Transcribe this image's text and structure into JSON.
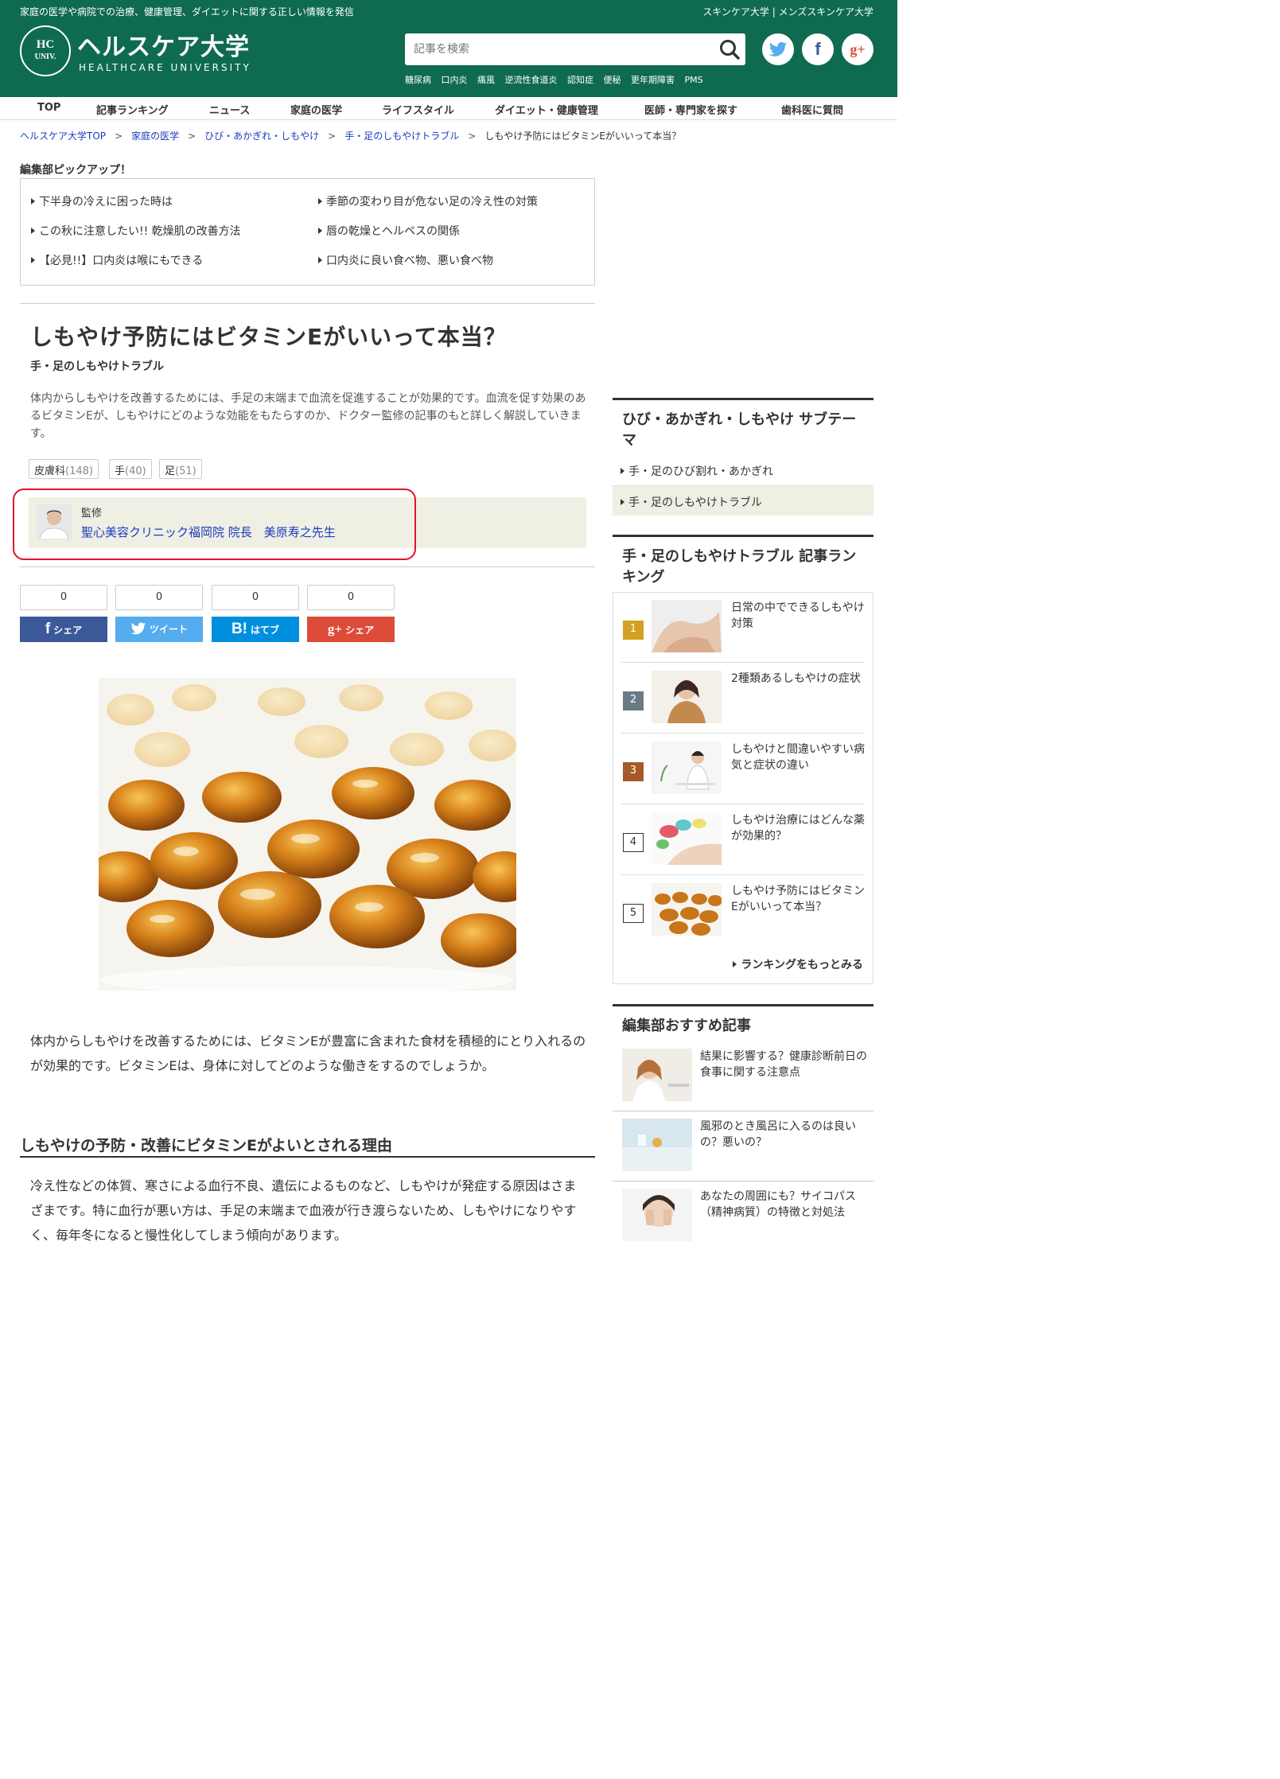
{
  "header": {
    "tagline": "家庭の医学や病院での治療、健康管理、ダイエットに関する正しい情報を発信",
    "top_link1": "スキンケア大学",
    "top_sep": "|",
    "top_link2": "メンズスキンケア大学",
    "logo_mark_line1": "HC",
    "logo_mark_line2": "UNIV.",
    "logo_title": "ヘルスケア大学",
    "logo_sub": "HEALTHCARE UNIVERSITY",
    "search_placeholder": "記事を検索",
    "keywords": [
      "糖尿病",
      "口内炎",
      "痛風",
      "逆流性食道炎",
      "認知症",
      "便秘",
      "更年期障害",
      "PMS"
    ],
    "social": [
      "twitter",
      "facebook",
      "google-plus"
    ]
  },
  "nav": [
    "TOP",
    "記事ランキング",
    "ニュース",
    "家庭の医学",
    "ライフスタイル",
    "ダイエット・健康管理",
    "医師・専門家を探す",
    "歯科医に質問"
  ],
  "breadcrumb": {
    "items": [
      "ヘルスケア大学TOP",
      "家庭の医学",
      "ひび・あかぎれ・しもやけ",
      "手・足のしもやけトラブル",
      "しもやけ予防にはビタミンEがいいって本当？"
    ],
    "sep": ">"
  },
  "picks": {
    "title": "編集部ピックアップ！",
    "items": [
      "下半身の冷えに困った時は",
      "季節の変わり目が危ない足の冷え性の対策",
      "この秋に注意したい!! 乾燥肌の改善方法",
      "唇の乾燥とヘルペスの関係",
      "【必見!!】口内炎は喉にもできる",
      "口内炎に良い食べ物、悪い食べ物"
    ]
  },
  "article": {
    "title": "しもやけ予防にはビタミンEがいいって本当？",
    "category": "手・足のしもやけトラブル",
    "lead": "体内からしもやけを改善するためには、手足の末端まで血流を促進することが効果的です。血流を促す効果のあるビタミンEが、しもやけにどのような効能をもたらすのか、ドクター監修の記事のもと詳しく解説していきます。",
    "tags": [
      {
        "name": "皮膚科",
        "count": "(148)"
      },
      {
        "name": "手",
        "count": "(40)"
      },
      {
        "name": "足",
        "count": "(51)"
      }
    ],
    "supervisor_label": "監修",
    "supervisor_name": "聖心美容クリニック福岡院 院長　美原寿之先生",
    "share_counts": [
      "0",
      "0",
      "0",
      "0"
    ],
    "share_labels": [
      "シェア",
      "ツイート",
      "はてブ",
      "シェア"
    ],
    "share_icons": [
      "f",
      "",
      "B!",
      "g+"
    ],
    "body1": "体内からしもやけを改善するためには、ビタミンEが豊富に含まれた食材を積極的にとり入れるのが効果的です。ビタミンEは、身体に対してどのような働きをするのでしょうか。",
    "h2": "しもやけの予防・改善にビタミンEがよいとされる理由",
    "body2": "冷え性などの体質、寒さによる血行不良、遺伝によるものなど、しもやけが発症する原因はさまざまです。特に血行が悪い方は、手足の末端まで血液が行き渡らないため、しもやけになりやすく、毎年冬になると慢性化してしまう傾向があります。"
  },
  "sidebar": {
    "subtheme_title": "ひび・あかぎれ・しもやけ サブテーマ",
    "subtheme_items": [
      "手・足のひび割れ・あかぎれ",
      "手・足のしもやけトラブル"
    ],
    "ranking_title": "手・足のしもやけトラブル 記事ランキング",
    "ranking": [
      {
        "rank": "1",
        "title": "日常の中でできるしもやけ対策"
      },
      {
        "rank": "2",
        "title": "2種類あるしもやけの症状"
      },
      {
        "rank": "3",
        "title": "しもやけと間違いやすい病気と症状の違い"
      },
      {
        "rank": "4",
        "title": "しもやけ治療にはどんな薬が効果的？"
      },
      {
        "rank": "5",
        "title": "しもやけ予防にはビタミンEがいいって本当？"
      }
    ],
    "ranking_more": "ランキングをもっとみる",
    "rec_title": "編集部おすすめ記事",
    "rec": [
      "結果に影響する？健康診断前日の食事に関する注意点",
      "風邪のとき風呂に入るのは良いの？悪いの？",
      "あなたの周囲にも？サイコパス（精神病質）の特徴と対処法"
    ]
  },
  "colors": {
    "brand_green": "#0e6b4f",
    "link_blue": "#1a3cc0",
    "highlight_red": "#e5112a",
    "facebook": "#3b5998",
    "twitter": "#55acee",
    "hatena": "#008fde",
    "google": "#dd4b39",
    "rank1": "#d4a020",
    "rank2": "#6b7b86",
    "rank3": "#a65a2a"
  }
}
